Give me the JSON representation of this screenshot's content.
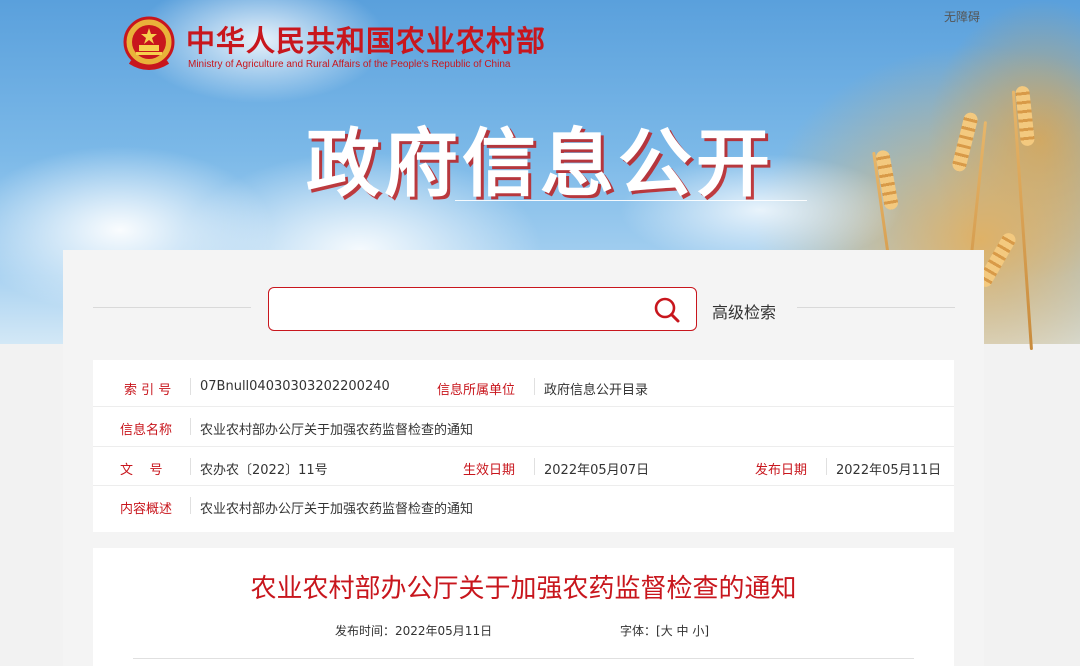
{
  "header": {
    "site_title_cn": "中华人民共和国农业农村部",
    "site_title_en": "Ministry of Agriculture and Rural Affairs of the People's Republic of China",
    "accessibility": "无障碍",
    "section_title": "政府信息公开"
  },
  "search": {
    "value": "",
    "placeholder": "",
    "advanced_label": "高级检索"
  },
  "info": {
    "index_label": "索 引 号",
    "index_value": "07Bnull04030303202200240",
    "unit_label": "信息所属单位",
    "unit_value": "政府信息公开目录",
    "name_label": "信息名称",
    "name_value": "农业农村部办公厅关于加强农药监督检查的通知",
    "doc_label": "文    号",
    "doc_value": "农办农〔2022〕11号",
    "effective_label": "生效日期",
    "effective_value": "2022年05月07日",
    "publish_label": "发布日期",
    "publish_value": "2022年05月11日",
    "summary_label": "内容概述",
    "summary_value": "农业农村部办公厅关于加强农药监督检查的通知"
  },
  "article": {
    "title": "农业农村部办公厅关于加强农药监督检查的通知",
    "publish_time": "发布时间：2022年05月11日",
    "font_label": "字体：[",
    "font_large": "大",
    "font_medium": "中",
    "font_small": "小",
    "font_close": "]"
  },
  "colors": {
    "accent": "#c8161d",
    "label": "#c8161d"
  }
}
